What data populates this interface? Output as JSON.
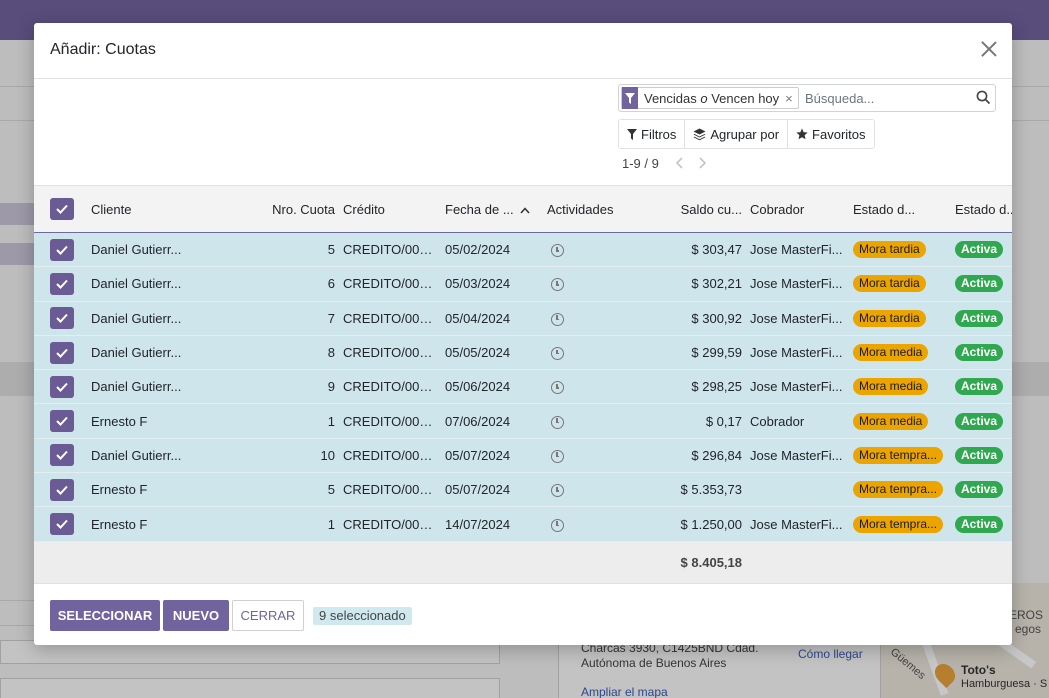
{
  "background": {
    "address_line1": "Charcas 3930, C1425BND Cdad.",
    "address_line2": "Autónoma de Buenos Aires",
    "directions_link": "Cómo llegar",
    "map_link": "Ampliar el mapa",
    "map_labels": [
      "EROS",
      "egos",
      "Güemes",
      "Toto's",
      "Hamburguesa · S"
    ]
  },
  "dialog": {
    "title": "Añadir: Cuotas",
    "search": {
      "facet_label": "Vencidas o Vencen hoy",
      "facet_remove": "×",
      "placeholder": "Búsqueda...",
      "value": ""
    },
    "filters": {
      "filters_label": "Filtros",
      "group_by_label": "Agrupar por",
      "favorites_label": "Favoritos"
    },
    "pager": {
      "range": "1-9 / 9"
    },
    "table": {
      "columns": [
        "Cliente",
        "Nro. Cuota",
        "Crédito",
        "Fecha de ...",
        "Actividades",
        "Saldo cu...",
        "Cobrador",
        "Estado d...",
        "Estado d..."
      ],
      "rows": [
        {
          "cliente": "Daniel Gutierr...",
          "nro": "5",
          "credito": "CREDITO/000...",
          "fecha": "05/02/2024",
          "saldo": "$ 303,47",
          "cobrador": "Jose MasterFi...",
          "estado1": "Mora tardia",
          "estado2": "Activa"
        },
        {
          "cliente": "Daniel Gutierr...",
          "nro": "6",
          "credito": "CREDITO/000...",
          "fecha": "05/03/2024",
          "saldo": "$ 302,21",
          "cobrador": "Jose MasterFi...",
          "estado1": "Mora tardia",
          "estado2": "Activa"
        },
        {
          "cliente": "Daniel Gutierr...",
          "nro": "7",
          "credito": "CREDITO/000...",
          "fecha": "05/04/2024",
          "saldo": "$ 300,92",
          "cobrador": "Jose MasterFi...",
          "estado1": "Mora tardia",
          "estado2": "Activa"
        },
        {
          "cliente": "Daniel Gutierr...",
          "nro": "8",
          "credito": "CREDITO/000...",
          "fecha": "05/05/2024",
          "saldo": "$ 299,59",
          "cobrador": "Jose MasterFi...",
          "estado1": "Mora media",
          "estado2": "Activa"
        },
        {
          "cliente": "Daniel Gutierr...",
          "nro": "9",
          "credito": "CREDITO/000...",
          "fecha": "05/06/2024",
          "saldo": "$ 298,25",
          "cobrador": "Jose MasterFi...",
          "estado1": "Mora media",
          "estado2": "Activa"
        },
        {
          "cliente": "Ernesto F",
          "nro": "1",
          "credito": "CREDITO/000...",
          "fecha": "07/06/2024",
          "saldo": "$ 0,17",
          "cobrador": "Cobrador",
          "estado1": "Mora media",
          "estado2": "Activa"
        },
        {
          "cliente": "Daniel Gutierr...",
          "nro": "10",
          "credito": "CREDITO/000...",
          "fecha": "05/07/2024",
          "saldo": "$ 296,84",
          "cobrador": "Jose MasterFi...",
          "estado1": "Mora tempra...",
          "estado2": "Activa"
        },
        {
          "cliente": "Ernesto F",
          "nro": "5",
          "credito": "CREDITO/000...",
          "fecha": "05/07/2024",
          "saldo": "$ 5.353,73",
          "cobrador": "",
          "estado1": "Mora tempra...",
          "estado2": "Activa"
        },
        {
          "cliente": "Ernesto F",
          "nro": "1",
          "credito": "CREDITO/000...",
          "fecha": "14/07/2024",
          "saldo": "$ 1.250,00",
          "cobrador": "Jose MasterFi...",
          "estado1": "Mora tempra...",
          "estado2": "Activa"
        }
      ],
      "total": "$ 8.405,18"
    },
    "footer": {
      "select_label": "SELECCIONAR",
      "new_label": "NUEVO",
      "close_label": "CERRAR",
      "selected_text": "9 seleccionado"
    }
  },
  "colors": {
    "brand": "#71639e",
    "checkbox": "#6b5b95",
    "row_selected": "#cfe5ec",
    "badge_warning": "#eca400",
    "badge_success": "#2fa84f"
  }
}
